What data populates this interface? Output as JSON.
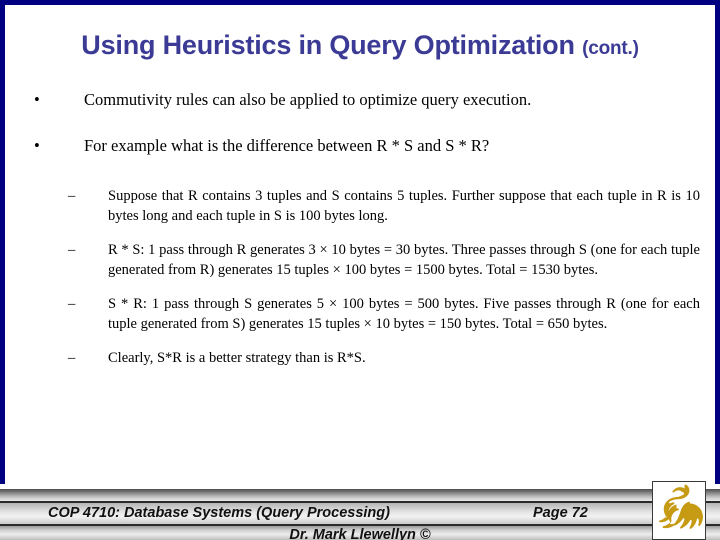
{
  "slide": {
    "title_main": "Using Heuristics in Query Optimization",
    "title_cont": "(cont.)",
    "title_color": "#3b3b96",
    "border_color": "#000080",
    "bullets": [
      {
        "marker": "•",
        "text": "Commutivity rules can also be applied to optimize query execution."
      },
      {
        "marker": "•",
        "text": "For example what is the difference between R * S and S * R?"
      }
    ],
    "sub_bullets": [
      {
        "marker": "–",
        "text": "Suppose that R contains 3 tuples and S contains 5 tuples.  Further suppose that each tuple in R is 10 bytes long and each tuple in S is 100 bytes long."
      },
      {
        "marker": "–",
        "text": "R * S: 1 pass through R generates 3 × 10 bytes = 30 bytes.  Three passes through S (one for each tuple generated from R) generates 15 tuples × 100 bytes = 1500 bytes.  Total = 1530 bytes."
      },
      {
        "marker": "–",
        "text": "S * R: 1 pass through S generates 5 × 100 bytes = 500 bytes.  Five passes through R (one for each tuple generated from S) generates 15 tuples × 10 bytes = 150 bytes.  Total = 650 bytes."
      },
      {
        "marker": "–",
        "text": "Clearly, S*R is a better strategy than is R*S."
      }
    ]
  },
  "footer": {
    "course": "COP 4710: Database Systems (Query Processing)",
    "page": "Page 72",
    "author": "Dr. Mark Llewellyn ©",
    "logo_name": "ucf-pegasus-logo",
    "logo_color": "#c79a14"
  }
}
